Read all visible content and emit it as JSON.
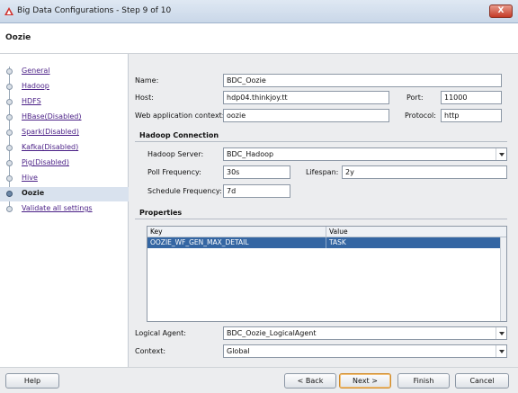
{
  "window": {
    "title": "Big Data Configurations - Step 9 of 10",
    "close_label": "X"
  },
  "page_title": "Oozie",
  "steps": [
    {
      "label": "General",
      "active": false
    },
    {
      "label": "Hadoop",
      "active": false
    },
    {
      "label": "HDFS",
      "active": false
    },
    {
      "label": "HBase(Disabled)",
      "active": false
    },
    {
      "label": "Spark(Disabled)",
      "active": false
    },
    {
      "label": "Kafka(Disabled)",
      "active": false
    },
    {
      "label": "Pig(Disabled)",
      "active": false
    },
    {
      "label": "Hive",
      "active": false
    },
    {
      "label": "Oozie",
      "active": true
    },
    {
      "label": "Validate all settings",
      "active": false
    }
  ],
  "form": {
    "name_label": "Name:",
    "name_value": "BDC_Oozie",
    "host_label": "Host:",
    "host_value": "hdp04.thinkjoy.tt",
    "port_label": "Port:",
    "port_value": "11000",
    "webctx_label": "Web application context:",
    "webctx_value": "oozie",
    "protocol_label": "Protocol:",
    "protocol_value": "http"
  },
  "hadoop_connection": {
    "section_title": "Hadoop Connection",
    "server_label": "Hadoop Server:",
    "server_value": "BDC_Hadoop",
    "poll_label": "Poll Frequency:",
    "poll_value": "30s",
    "lifespan_label": "Lifespan:",
    "lifespan_value": "2y",
    "schedule_label": "Schedule Frequency:",
    "schedule_value": "7d"
  },
  "properties": {
    "section_title": "Properties",
    "columns": [
      "Key",
      "Value"
    ],
    "rows": [
      {
        "key": "OOZIE_WF_GEN_MAX_DETAIL",
        "value": "TASK"
      }
    ]
  },
  "bottom_fields": {
    "logical_agent_label": "Logical Agent:",
    "logical_agent_value": "BDC_Oozie_LogicalAgent",
    "context_label": "Context:",
    "context_value": "Global"
  },
  "buttons": {
    "help": "Help",
    "back": "< Back",
    "next": "Next >",
    "finish": "Finish",
    "cancel": "Cancel"
  },
  "colors": {
    "selection": "#3466a3",
    "link": "#4a1f86",
    "header_gradient_top": "#dfe8f3"
  }
}
